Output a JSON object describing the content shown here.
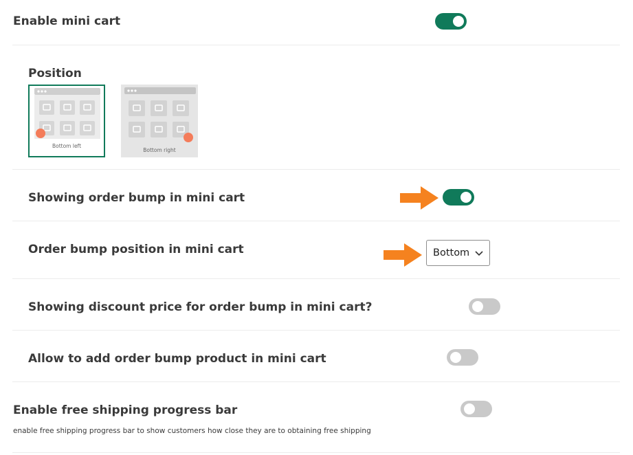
{
  "settings": {
    "enable_mini_cart": {
      "label": "Enable mini cart",
      "enabled": true
    },
    "position": {
      "label": "Position",
      "options": [
        {
          "caption": "Bottom left",
          "selected": true
        },
        {
          "caption": "Bottom right",
          "selected": false
        }
      ]
    },
    "order_bump": {
      "label": "Showing order bump in mini cart",
      "enabled": true
    },
    "order_bump_position": {
      "label": "Order bump position in mini cart",
      "selected": "Bottom"
    },
    "discount_price": {
      "label": "Showing discount price for order bump in mini cart?",
      "enabled": false
    },
    "allow_add": {
      "label": "Allow to add order bump product in mini cart",
      "enabled": false
    },
    "free_shipping": {
      "label": "Enable free shipping progress bar",
      "description": "enable free shipping progress bar to show customers how close they are to obtaining free shipping",
      "enabled": false
    }
  },
  "colors": {
    "accent": "#107a5a",
    "toggle_off": "#c9c9c9",
    "annotation_arrow": "#f5821f",
    "mini_cart_dot": "#f47c5a"
  },
  "icons": [
    "arrow-right-icon",
    "chevron-down-icon",
    "image-placeholder-icon"
  ]
}
